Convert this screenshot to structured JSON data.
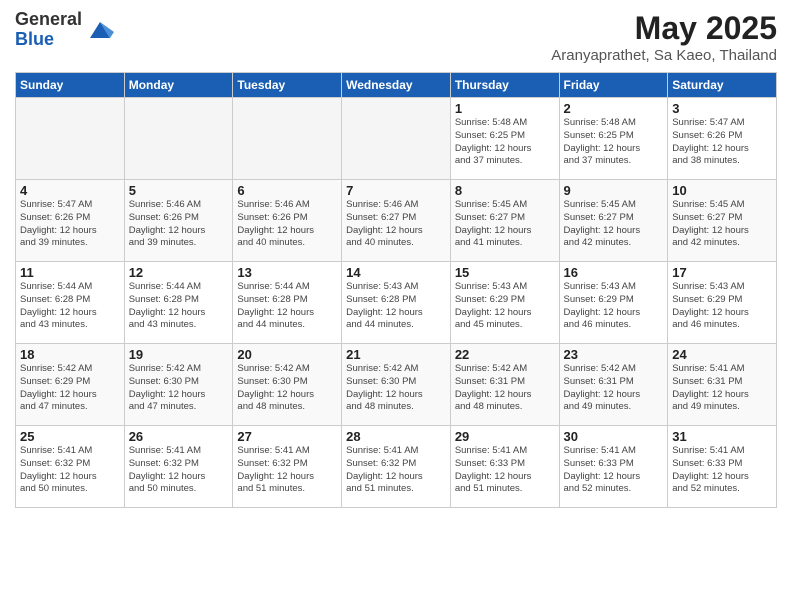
{
  "logo": {
    "general": "General",
    "blue": "Blue"
  },
  "title": "May 2025",
  "subtitle": "Aranyaprathet, Sa Kaeo, Thailand",
  "days_of_week": [
    "Sunday",
    "Monday",
    "Tuesday",
    "Wednesday",
    "Thursday",
    "Friday",
    "Saturday"
  ],
  "weeks": [
    [
      {
        "day": "",
        "info": ""
      },
      {
        "day": "",
        "info": ""
      },
      {
        "day": "",
        "info": ""
      },
      {
        "day": "",
        "info": ""
      },
      {
        "day": "1",
        "info": "Sunrise: 5:48 AM\nSunset: 6:25 PM\nDaylight: 12 hours\nand 37 minutes."
      },
      {
        "day": "2",
        "info": "Sunrise: 5:48 AM\nSunset: 6:25 PM\nDaylight: 12 hours\nand 37 minutes."
      },
      {
        "day": "3",
        "info": "Sunrise: 5:47 AM\nSunset: 6:26 PM\nDaylight: 12 hours\nand 38 minutes."
      }
    ],
    [
      {
        "day": "4",
        "info": "Sunrise: 5:47 AM\nSunset: 6:26 PM\nDaylight: 12 hours\nand 39 minutes."
      },
      {
        "day": "5",
        "info": "Sunrise: 5:46 AM\nSunset: 6:26 PM\nDaylight: 12 hours\nand 39 minutes."
      },
      {
        "day": "6",
        "info": "Sunrise: 5:46 AM\nSunset: 6:26 PM\nDaylight: 12 hours\nand 40 minutes."
      },
      {
        "day": "7",
        "info": "Sunrise: 5:46 AM\nSunset: 6:27 PM\nDaylight: 12 hours\nand 40 minutes."
      },
      {
        "day": "8",
        "info": "Sunrise: 5:45 AM\nSunset: 6:27 PM\nDaylight: 12 hours\nand 41 minutes."
      },
      {
        "day": "9",
        "info": "Sunrise: 5:45 AM\nSunset: 6:27 PM\nDaylight: 12 hours\nand 42 minutes."
      },
      {
        "day": "10",
        "info": "Sunrise: 5:45 AM\nSunset: 6:27 PM\nDaylight: 12 hours\nand 42 minutes."
      }
    ],
    [
      {
        "day": "11",
        "info": "Sunrise: 5:44 AM\nSunset: 6:28 PM\nDaylight: 12 hours\nand 43 minutes."
      },
      {
        "day": "12",
        "info": "Sunrise: 5:44 AM\nSunset: 6:28 PM\nDaylight: 12 hours\nand 43 minutes."
      },
      {
        "day": "13",
        "info": "Sunrise: 5:44 AM\nSunset: 6:28 PM\nDaylight: 12 hours\nand 44 minutes."
      },
      {
        "day": "14",
        "info": "Sunrise: 5:43 AM\nSunset: 6:28 PM\nDaylight: 12 hours\nand 44 minutes."
      },
      {
        "day": "15",
        "info": "Sunrise: 5:43 AM\nSunset: 6:29 PM\nDaylight: 12 hours\nand 45 minutes."
      },
      {
        "day": "16",
        "info": "Sunrise: 5:43 AM\nSunset: 6:29 PM\nDaylight: 12 hours\nand 46 minutes."
      },
      {
        "day": "17",
        "info": "Sunrise: 5:43 AM\nSunset: 6:29 PM\nDaylight: 12 hours\nand 46 minutes."
      }
    ],
    [
      {
        "day": "18",
        "info": "Sunrise: 5:42 AM\nSunset: 6:29 PM\nDaylight: 12 hours\nand 47 minutes."
      },
      {
        "day": "19",
        "info": "Sunrise: 5:42 AM\nSunset: 6:30 PM\nDaylight: 12 hours\nand 47 minutes."
      },
      {
        "day": "20",
        "info": "Sunrise: 5:42 AM\nSunset: 6:30 PM\nDaylight: 12 hours\nand 48 minutes."
      },
      {
        "day": "21",
        "info": "Sunrise: 5:42 AM\nSunset: 6:30 PM\nDaylight: 12 hours\nand 48 minutes."
      },
      {
        "day": "22",
        "info": "Sunrise: 5:42 AM\nSunset: 6:31 PM\nDaylight: 12 hours\nand 48 minutes."
      },
      {
        "day": "23",
        "info": "Sunrise: 5:42 AM\nSunset: 6:31 PM\nDaylight: 12 hours\nand 49 minutes."
      },
      {
        "day": "24",
        "info": "Sunrise: 5:41 AM\nSunset: 6:31 PM\nDaylight: 12 hours\nand 49 minutes."
      }
    ],
    [
      {
        "day": "25",
        "info": "Sunrise: 5:41 AM\nSunset: 6:32 PM\nDaylight: 12 hours\nand 50 minutes."
      },
      {
        "day": "26",
        "info": "Sunrise: 5:41 AM\nSunset: 6:32 PM\nDaylight: 12 hours\nand 50 minutes."
      },
      {
        "day": "27",
        "info": "Sunrise: 5:41 AM\nSunset: 6:32 PM\nDaylight: 12 hours\nand 51 minutes."
      },
      {
        "day": "28",
        "info": "Sunrise: 5:41 AM\nSunset: 6:32 PM\nDaylight: 12 hours\nand 51 minutes."
      },
      {
        "day": "29",
        "info": "Sunrise: 5:41 AM\nSunset: 6:33 PM\nDaylight: 12 hours\nand 51 minutes."
      },
      {
        "day": "30",
        "info": "Sunrise: 5:41 AM\nSunset: 6:33 PM\nDaylight: 12 hours\nand 52 minutes."
      },
      {
        "day": "31",
        "info": "Sunrise: 5:41 AM\nSunset: 6:33 PM\nDaylight: 12 hours\nand 52 minutes."
      }
    ]
  ]
}
